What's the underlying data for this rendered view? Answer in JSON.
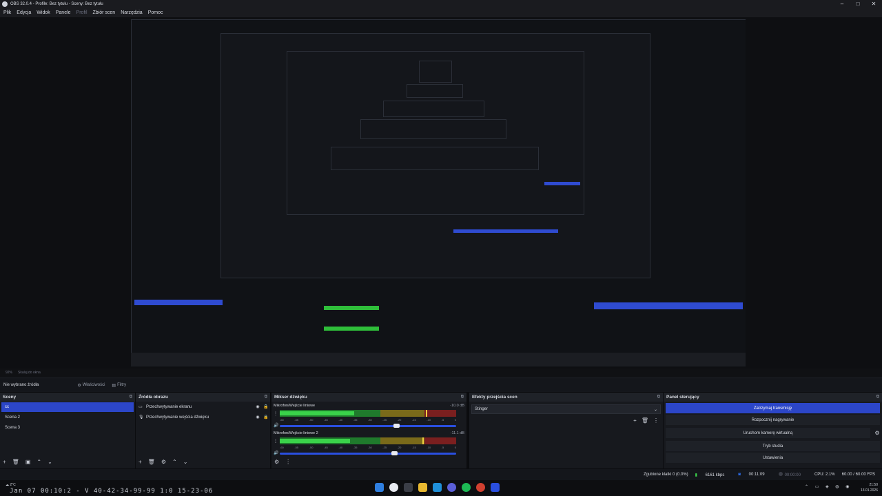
{
  "window": {
    "title": "OBS 32.0.4 - Profile: Bez tytułu - Sceny: Bez tytułu",
    "minimize": "–",
    "maximize": "□",
    "close": "✕"
  },
  "menu": {
    "items": [
      "Plik",
      "Edycja",
      "Widok",
      "Panele",
      "Profil",
      "Zbiór scen",
      "Narzędzia",
      "Pomoc"
    ]
  },
  "preview": {
    "zoom": "92%",
    "fit": "Skaluj do okna"
  },
  "context": {
    "no_source": "Nie wybrano źródła",
    "properties": "Właściwości",
    "filters": "Filtry"
  },
  "scenes": {
    "title": "Sceny",
    "items": [
      {
        "label": "cc",
        "selected": true
      },
      {
        "label": "Scena 2",
        "selected": false
      },
      {
        "label": "Scena 3",
        "selected": false
      }
    ]
  },
  "sources": {
    "title": "Źródła obrazu",
    "items": [
      {
        "label": "Przechwytywanie ekranu",
        "icon": "monitor-icon"
      },
      {
        "label": "Przechwytywanie wejścia dźwięku",
        "icon": "microphone-icon"
      }
    ]
  },
  "mixer": {
    "title": "Mikser dźwięku",
    "ticks": [
      "-60",
      "-55",
      "-50",
      "-45",
      "-40",
      "-35",
      "-30",
      "-25",
      "-20",
      "-15",
      "-10",
      "-5",
      "0"
    ],
    "channels": [
      {
        "name": "Mikrofon/Wejście liniowe",
        "db": "-10.0 dB",
        "level": 0.42,
        "peak": 0.83,
        "volume": 0.66
      },
      {
        "name": "Mikrofon/Wejście liniowe 2",
        "db": "-11.1 dB",
        "level": 0.4,
        "peak": 0.81,
        "volume": 0.65
      }
    ]
  },
  "transitions": {
    "title": "Efekty przejścia scen",
    "selected": "Stinger"
  },
  "controls": {
    "title": "Panel sterujący",
    "stop_stream": "Zatrzymaj transmisję",
    "start_record": "Rozpocznij nagrywanie",
    "virtual_cam": "Uruchom kamerę wirtualną",
    "studio_mode": "Tryb studia",
    "settings": "Ustawienia"
  },
  "status": {
    "dropped": "Zgubione klatki 0 (0.0%)",
    "bitrate": "6161 kbps",
    "stream_time": "00:11:09",
    "rec_time": "00:00:00",
    "cpu": "CPU: 2.1%",
    "fps": "60.00 / 60.00 FPS"
  },
  "taskbar": {
    "weather": "2°C",
    "overlay_text": "Jan 07 00:10:2 - V 40-42-34-99-99 1:0 15-23-06",
    "time": "21:50",
    "date": "13.01.2026"
  },
  "colors": {
    "accent": "#2c46c8",
    "meter_green": "#3ad24a",
    "meter_yellow": "#7a6a1a",
    "meter_red": "#7a1f1f"
  }
}
